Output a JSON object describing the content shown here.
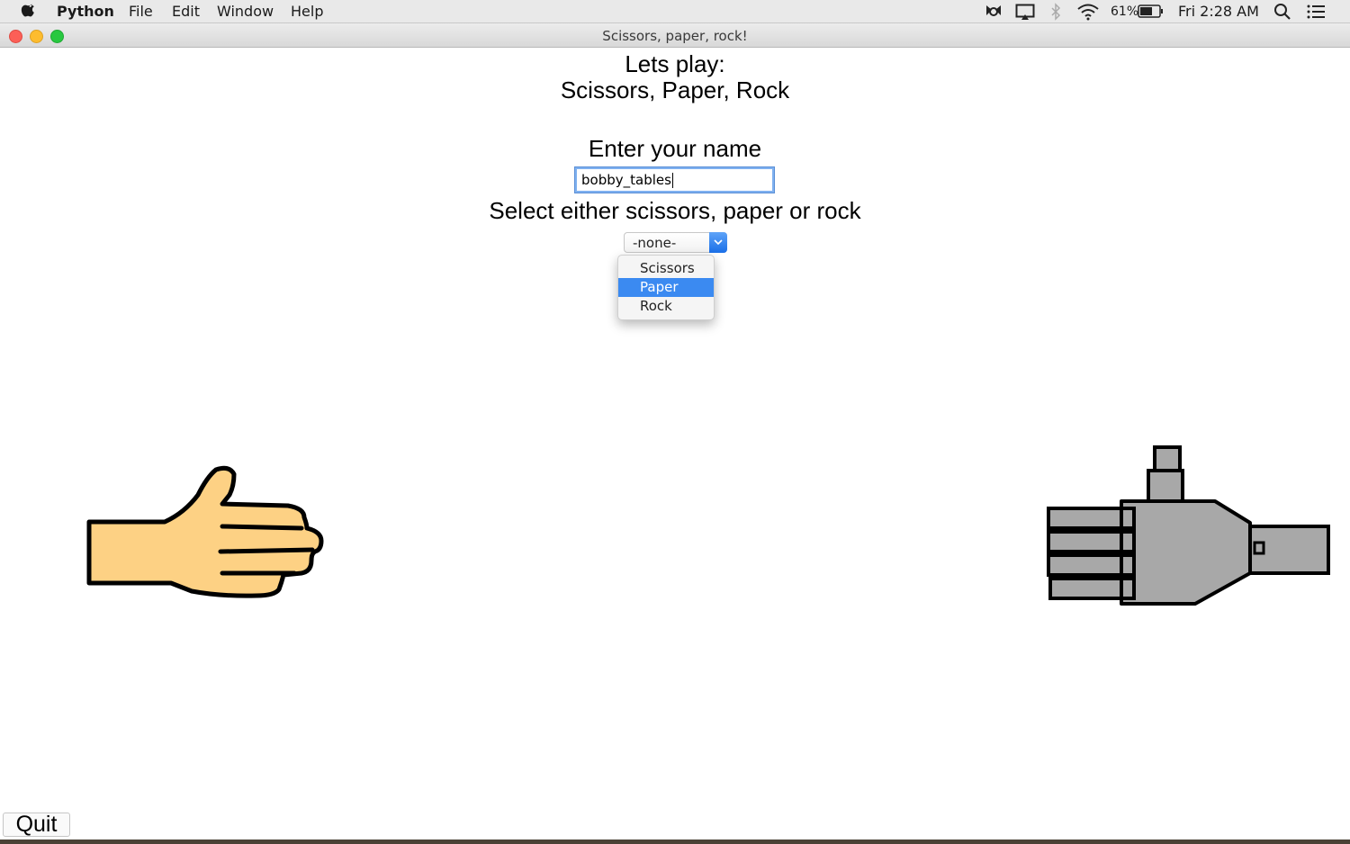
{
  "menubar": {
    "app_name": "Python",
    "items": [
      "File",
      "Edit",
      "Window",
      "Help"
    ],
    "battery": "61%",
    "clock": "Fri 2:28 AM"
  },
  "window": {
    "title": "Scissors, paper, rock!"
  },
  "main": {
    "heading_line1": "Lets play:",
    "heading_line2": "Scissors, Paper, Rock",
    "name_prompt": "Enter your name",
    "name_value": "bobby_tables",
    "select_prompt": "Select either scissors, paper or rock",
    "select_value": "-none-",
    "options": [
      "Scissors",
      "Paper",
      "Rock"
    ],
    "highlighted_option": "Paper",
    "quit_label": "Quit"
  },
  "hands": {
    "player_hand": "paper-hand-icon",
    "computer_hand": "robot-hand-icon"
  },
  "colors": {
    "skin": "#fdd184",
    "robot_gray": "#a8a8a8",
    "highlight": "#3b8af1",
    "focus_ring": "#7fb1f0"
  }
}
